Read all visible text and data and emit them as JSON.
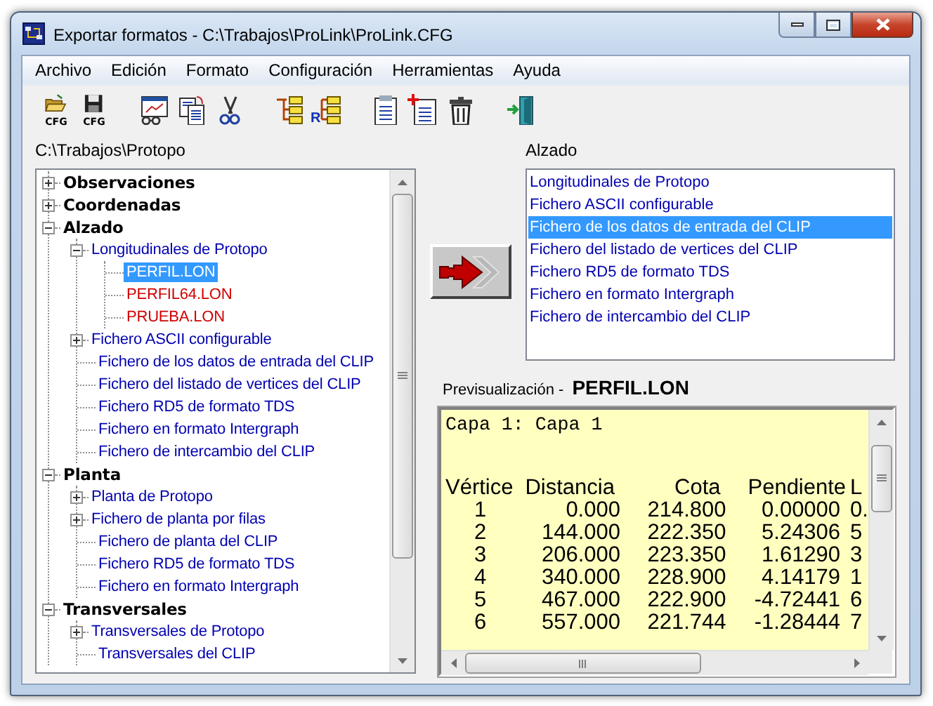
{
  "window": {
    "title": "Exportar formatos - C:\\Trabajos\\ProLink\\ProLink.CFG"
  },
  "menu": [
    "Archivo",
    "Edición",
    "Formato",
    "Configuración",
    "Herramientas",
    "Ayuda"
  ],
  "toolbar": [
    [
      {
        "kind": "open",
        "caption": "CFG"
      },
      {
        "kind": "save",
        "caption": "CFG"
      }
    ],
    [
      {
        "kind": "preview"
      },
      {
        "kind": "paste"
      },
      {
        "kind": "cut"
      }
    ],
    [
      {
        "kind": "tree"
      },
      {
        "kind": "tree_r",
        "caption": "R"
      }
    ],
    [
      {
        "kind": "doc"
      },
      {
        "kind": "doc_add"
      },
      {
        "kind": "delete"
      }
    ],
    [
      {
        "kind": "exit"
      }
    ]
  ],
  "tree": {
    "path": "C:\\Trabajos\\Protopo",
    "nodes": [
      {
        "label": "Observaciones",
        "kind": "category",
        "expanded": false,
        "selected": false
      },
      {
        "label": "Coordenadas",
        "kind": "category",
        "expanded": false,
        "selected": false
      },
      {
        "label": "Alzado",
        "kind": "category",
        "expanded": true,
        "selected": false,
        "children": [
          {
            "label": "Longitudinales de Protopo",
            "kind": "format",
            "expanded": true,
            "selected": false,
            "children": [
              {
                "label": "PERFIL.LON",
                "kind": "file",
                "selected": true
              },
              {
                "label": "PERFIL64.LON",
                "kind": "file",
                "selected": false
              },
              {
                "label": "PRUEBA.LON",
                "kind": "file",
                "selected": false
              }
            ]
          },
          {
            "label": "Fichero ASCII configurable",
            "kind": "format",
            "expanded": false,
            "selected": false
          },
          {
            "label": "Fichero de los datos de entrada del CLIP",
            "kind": "format",
            "selected": false
          },
          {
            "label": "Fichero del listado de vertices del CLIP",
            "kind": "format",
            "selected": false
          },
          {
            "label": "Fichero RD5 de formato TDS",
            "kind": "format",
            "selected": false
          },
          {
            "label": "Fichero en formato Intergraph",
            "kind": "format",
            "selected": false
          },
          {
            "label": "Fichero de intercambio del CLIP",
            "kind": "format",
            "selected": false
          }
        ]
      },
      {
        "label": "Planta",
        "kind": "category",
        "expanded": true,
        "selected": false,
        "children": [
          {
            "label": "Planta de Protopo",
            "kind": "format",
            "expanded": false,
            "selected": false
          },
          {
            "label": "Fichero de planta por filas",
            "kind": "format",
            "expanded": false,
            "selected": false
          },
          {
            "label": "Fichero de planta del CLIP",
            "kind": "format",
            "selected": false
          },
          {
            "label": "Fichero RD5 de formato TDS",
            "kind": "format",
            "selected": false
          },
          {
            "label": "Fichero en formato Intergraph",
            "kind": "format",
            "selected": false
          }
        ]
      },
      {
        "label": "Transversales",
        "kind": "category",
        "expanded": true,
        "selected": false,
        "children": [
          {
            "label": "Transversales de Protopo",
            "kind": "format",
            "expanded": false,
            "selected": false
          },
          {
            "label": "Transversales del CLIP",
            "kind": "format",
            "selected": false
          }
        ]
      }
    ]
  },
  "list": {
    "title": "Alzado",
    "items": [
      {
        "label": "Longitudinales de Protopo",
        "selected": false
      },
      {
        "label": "Fichero ASCII configurable",
        "selected": false
      },
      {
        "label": "Fichero de los datos de entrada del CLIP",
        "selected": true
      },
      {
        "label": "Fichero del listado de vertices del CLIP",
        "selected": false
      },
      {
        "label": "Fichero RD5 de formato TDS",
        "selected": false
      },
      {
        "label": "Fichero en formato Intergraph",
        "selected": false
      },
      {
        "label": "Fichero de intercambio del CLIP",
        "selected": false
      }
    ]
  },
  "preview": {
    "label": "Previsualización -",
    "file": "PERFIL.LON",
    "heading": "Capa 1: Capa 1",
    "columns": [
      "Vértice",
      "Distancia",
      "Cota",
      "Pendiente",
      "L"
    ],
    "rows": [
      [
        "1",
        "0.000",
        "214.800",
        "0.00000",
        "0."
      ],
      [
        "2",
        "144.000",
        "222.350",
        "5.24306",
        "5"
      ],
      [
        "3",
        "206.000",
        "223.350",
        "1.61290",
        "3"
      ],
      [
        "4",
        "340.000",
        "228.900",
        "4.14179",
        "1"
      ],
      [
        "5",
        "467.000",
        "222.900",
        "-4.72441",
        "6"
      ],
      [
        "6",
        "557.000",
        "221.744",
        "-1.28444",
        "7"
      ]
    ]
  }
}
